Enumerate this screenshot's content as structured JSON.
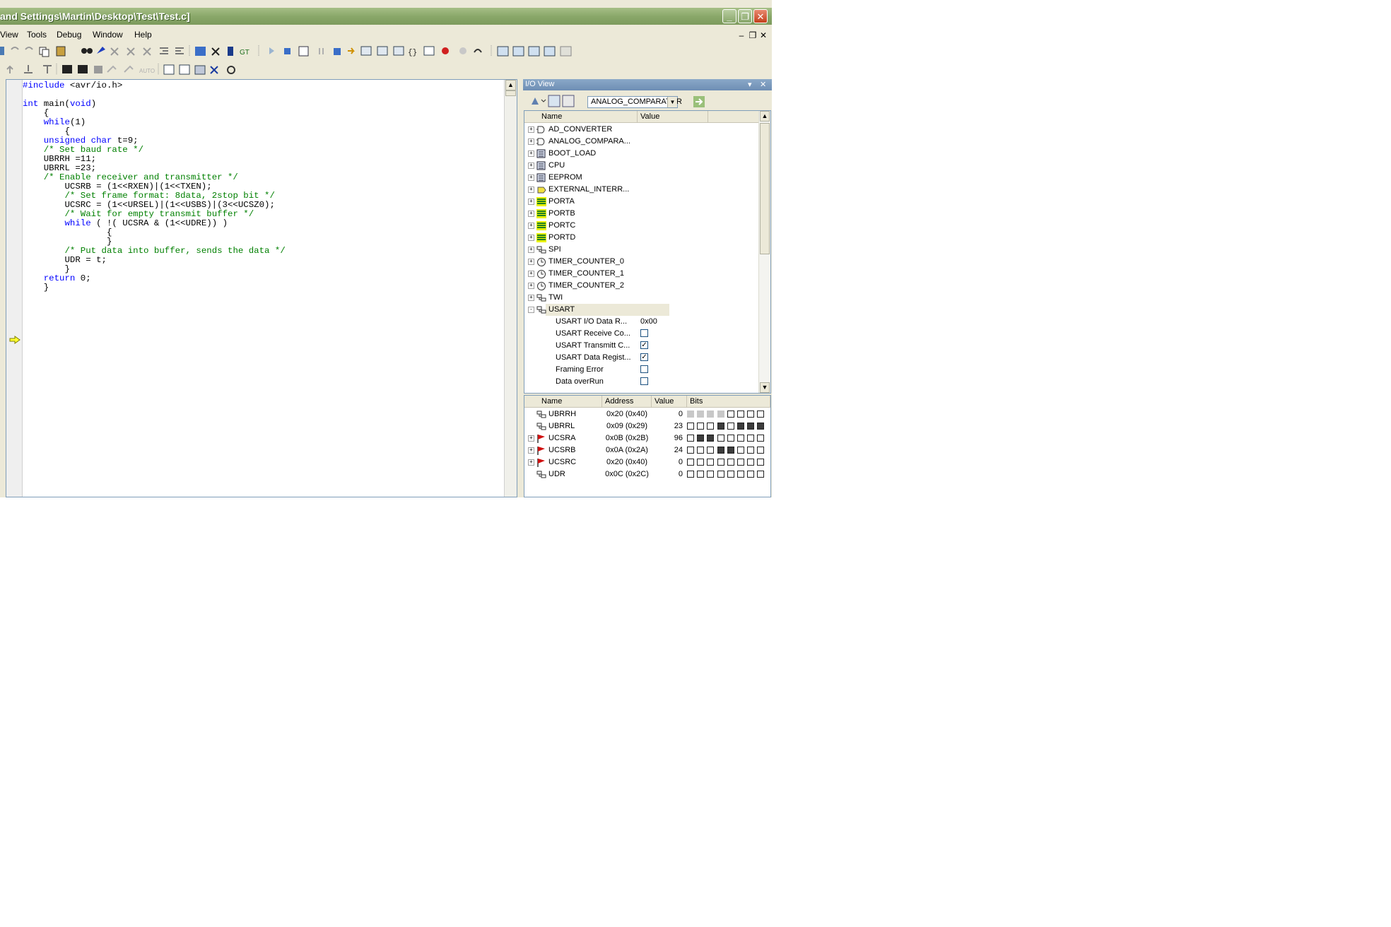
{
  "window": {
    "title": "and Settings\\Martin\\Desktop\\Test\\Test.c]"
  },
  "menubar": {
    "items": [
      "View",
      "Tools",
      "Debug",
      "Window",
      "Help"
    ]
  },
  "editor": {
    "lines": [
      [
        {
          "t": "#include",
          "c": "pp"
        },
        {
          "t": " <avr/io.h>",
          "c": ""
        }
      ],
      [],
      [
        {
          "t": "int",
          "c": "kw"
        },
        {
          "t": " main(",
          "c": ""
        },
        {
          "t": "void",
          "c": "kw"
        },
        {
          "t": ")",
          "c": ""
        }
      ],
      [
        {
          "t": "    {",
          "c": ""
        }
      ],
      [
        {
          "t": "    ",
          "c": ""
        },
        {
          "t": "while",
          "c": "kw"
        },
        {
          "t": "(1)",
          "c": ""
        }
      ],
      [
        {
          "t": "        {",
          "c": ""
        }
      ],
      [
        {
          "t": "    ",
          "c": ""
        },
        {
          "t": "unsigned char",
          "c": "kw"
        },
        {
          "t": " t=9;",
          "c": ""
        }
      ],
      [
        {
          "t": "    ",
          "c": ""
        },
        {
          "t": "/* Set baud rate */",
          "c": "cm"
        }
      ],
      [
        {
          "t": "    UBRRH =11;",
          "c": ""
        }
      ],
      [
        {
          "t": "    UBRRL =23;",
          "c": ""
        }
      ],
      [
        {
          "t": "    ",
          "c": ""
        },
        {
          "t": "/* Enable receiver and transmitter */",
          "c": "cm"
        }
      ],
      [
        {
          "t": "        UCSRB = (1<<RXEN)|(1<<TXEN);",
          "c": ""
        }
      ],
      [
        {
          "t": "        ",
          "c": ""
        },
        {
          "t": "/* Set frame format: 8data, 2stop bit */",
          "c": "cm"
        }
      ],
      [
        {
          "t": "        UCSRC = (1<<URSEL)|(1<<USBS)|(3<<UCSZ0);",
          "c": ""
        }
      ],
      [
        {
          "t": "        ",
          "c": ""
        },
        {
          "t": "/* Wait for empty transmit buffer */",
          "c": "cm"
        }
      ],
      [
        {
          "t": "        ",
          "c": ""
        },
        {
          "t": "while",
          "c": "kw"
        },
        {
          "t": " ( !( UCSRA & (1<<UDRE)) )",
          "c": ""
        }
      ],
      [
        {
          "t": "                {",
          "c": ""
        }
      ],
      [
        {
          "t": "                }",
          "c": ""
        }
      ],
      [
        {
          "t": "        ",
          "c": ""
        },
        {
          "t": "/* Put data into buffer, sends the data */",
          "c": "cm"
        }
      ],
      [
        {
          "t": "        UDR = t;",
          "c": ""
        }
      ],
      [
        {
          "t": "        }",
          "c": ""
        }
      ],
      [
        {
          "t": "    ",
          "c": ""
        },
        {
          "t": "return",
          "c": "kw"
        },
        {
          "t": " 0;",
          "c": ""
        }
      ],
      [
        {
          "t": "    }",
          "c": ""
        }
      ]
    ]
  },
  "io_view": {
    "title": "I/O View",
    "combo_value": "ANALOG_COMPARATOR",
    "columns": {
      "name": "Name",
      "value": "Value"
    },
    "modules": [
      {
        "name": "AD_CONVERTER",
        "icon": "adc-icon",
        "expander": "+"
      },
      {
        "name": "ANALOG_COMPARA...",
        "icon": "comparator-icon",
        "expander": "+"
      },
      {
        "name": "BOOT_LOAD",
        "icon": "memory-icon",
        "expander": "+"
      },
      {
        "name": "CPU",
        "icon": "memory-icon",
        "expander": "+"
      },
      {
        "name": "EEPROM",
        "icon": "memory-icon",
        "expander": "+"
      },
      {
        "name": "EXTERNAL_INTERR...",
        "icon": "interrupt-icon",
        "expander": "+"
      },
      {
        "name": "PORTA",
        "icon": "port-icon",
        "expander": "+"
      },
      {
        "name": "PORTB",
        "icon": "port-icon",
        "expander": "+"
      },
      {
        "name": "PORTC",
        "icon": "port-icon",
        "expander": "+"
      },
      {
        "name": "PORTD",
        "icon": "port-icon",
        "expander": "+"
      },
      {
        "name": "SPI",
        "icon": "bus-icon",
        "expander": "+"
      },
      {
        "name": "TIMER_COUNTER_0",
        "icon": "timer-icon",
        "expander": "+"
      },
      {
        "name": "TIMER_COUNTER_1",
        "icon": "timer-icon",
        "expander": "+"
      },
      {
        "name": "TIMER_COUNTER_2",
        "icon": "timer-icon",
        "expander": "+"
      },
      {
        "name": "TWI",
        "icon": "bus-icon",
        "expander": "+"
      },
      {
        "name": "USART",
        "icon": "bus-icon",
        "expander": "-"
      }
    ],
    "usart_fields": [
      {
        "name": "USART I/O Data R...",
        "value": "0x00",
        "checkbox": null
      },
      {
        "name": "USART Receive Co...",
        "value": "",
        "checkbox": false
      },
      {
        "name": "USART Transmitt C...",
        "value": "",
        "checkbox": true
      },
      {
        "name": "USART Data Regist...",
        "value": "",
        "checkbox": true
      },
      {
        "name": "Framing Error",
        "value": "",
        "checkbox": false
      },
      {
        "name": "Data overRun",
        "value": "",
        "checkbox": false
      }
    ],
    "register_columns": {
      "name": "Name",
      "address": "Address",
      "value": "Value",
      "bits": "Bits"
    },
    "registers": [
      {
        "name": "UBRRH",
        "address": "0x20 (0x40)",
        "value": "0",
        "flag": false,
        "expander": "",
        "bits": "nnnn0000"
      },
      {
        "name": "UBRRL",
        "address": "0x09 (0x29)",
        "value": "23",
        "flag": false,
        "expander": "",
        "bits": "00010111"
      },
      {
        "name": "UCSRA",
        "address": "0x0B (0x2B)",
        "value": "96",
        "flag": true,
        "expander": "+",
        "bits": "01100000"
      },
      {
        "name": "UCSRB",
        "address": "0x0A (0x2A)",
        "value": "24",
        "flag": true,
        "expander": "+",
        "bits": "00011000"
      },
      {
        "name": "UCSRC",
        "address": "0x20 (0x40)",
        "value": "0",
        "flag": true,
        "expander": "+",
        "bits": "00000000"
      },
      {
        "name": "UDR",
        "address": "0x0C (0x2C)",
        "value": "0",
        "flag": false,
        "expander": "",
        "bits": "00000000"
      }
    ]
  },
  "colors": {
    "keyword": "#0000ff",
    "comment": "#008000",
    "title_bar": "#8aa86a",
    "bit_set": "#3c3c3c",
    "bit_unavailable": "#c8c8c8"
  }
}
